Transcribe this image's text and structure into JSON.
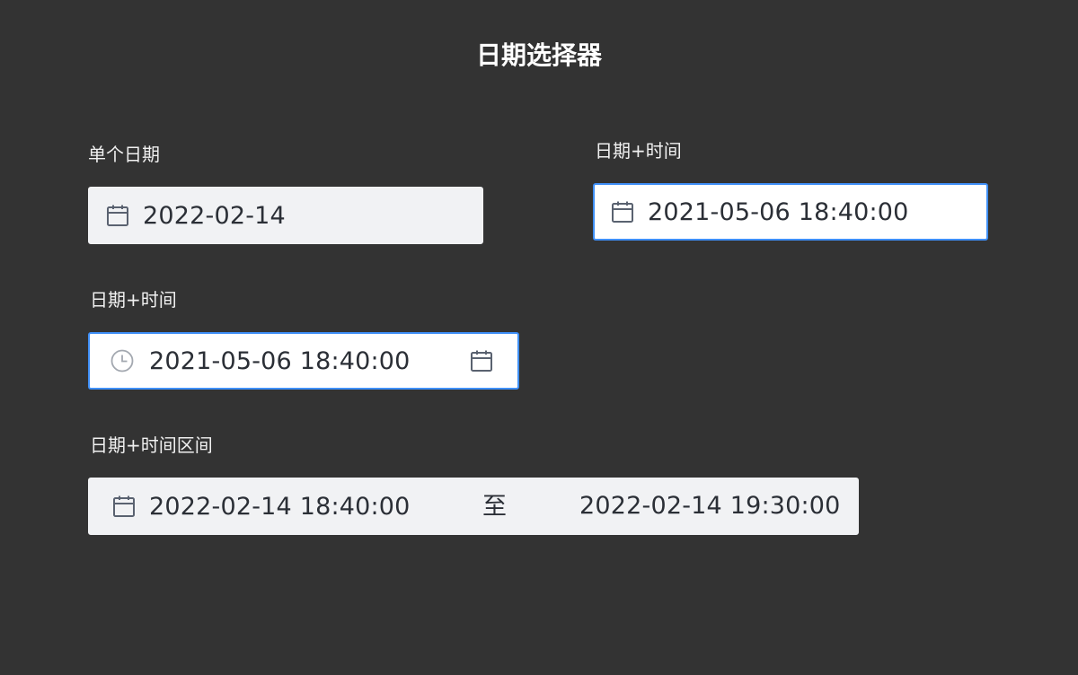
{
  "page": {
    "title": "日期选择器"
  },
  "single_date": {
    "label": "单个日期",
    "value": "2022-02-14",
    "icon": "calendar-icon"
  },
  "datetime_a": {
    "label": "日期+时间",
    "value": "2021-05-06 18:40:00",
    "icon": "calendar-icon",
    "focused": true
  },
  "datetime_b": {
    "label": "日期+时间",
    "value": "2021-05-06 18:40:00",
    "prefix_icon": "clock-icon",
    "suffix_icon": "calendar-icon",
    "focused": true
  },
  "datetime_range": {
    "label": "日期+时间区间",
    "start": "2022-02-14 18:40:00",
    "separator": "至",
    "end": "2022-02-14 19:30:00",
    "icon": "calendar-icon"
  },
  "colors": {
    "background": "#333333",
    "input_bg": "#f1f2f4",
    "focus_border": "#3f8ff7",
    "text": "#2b2f36",
    "icon": "#5a6270",
    "icon_muted": "#a3a8b0"
  }
}
